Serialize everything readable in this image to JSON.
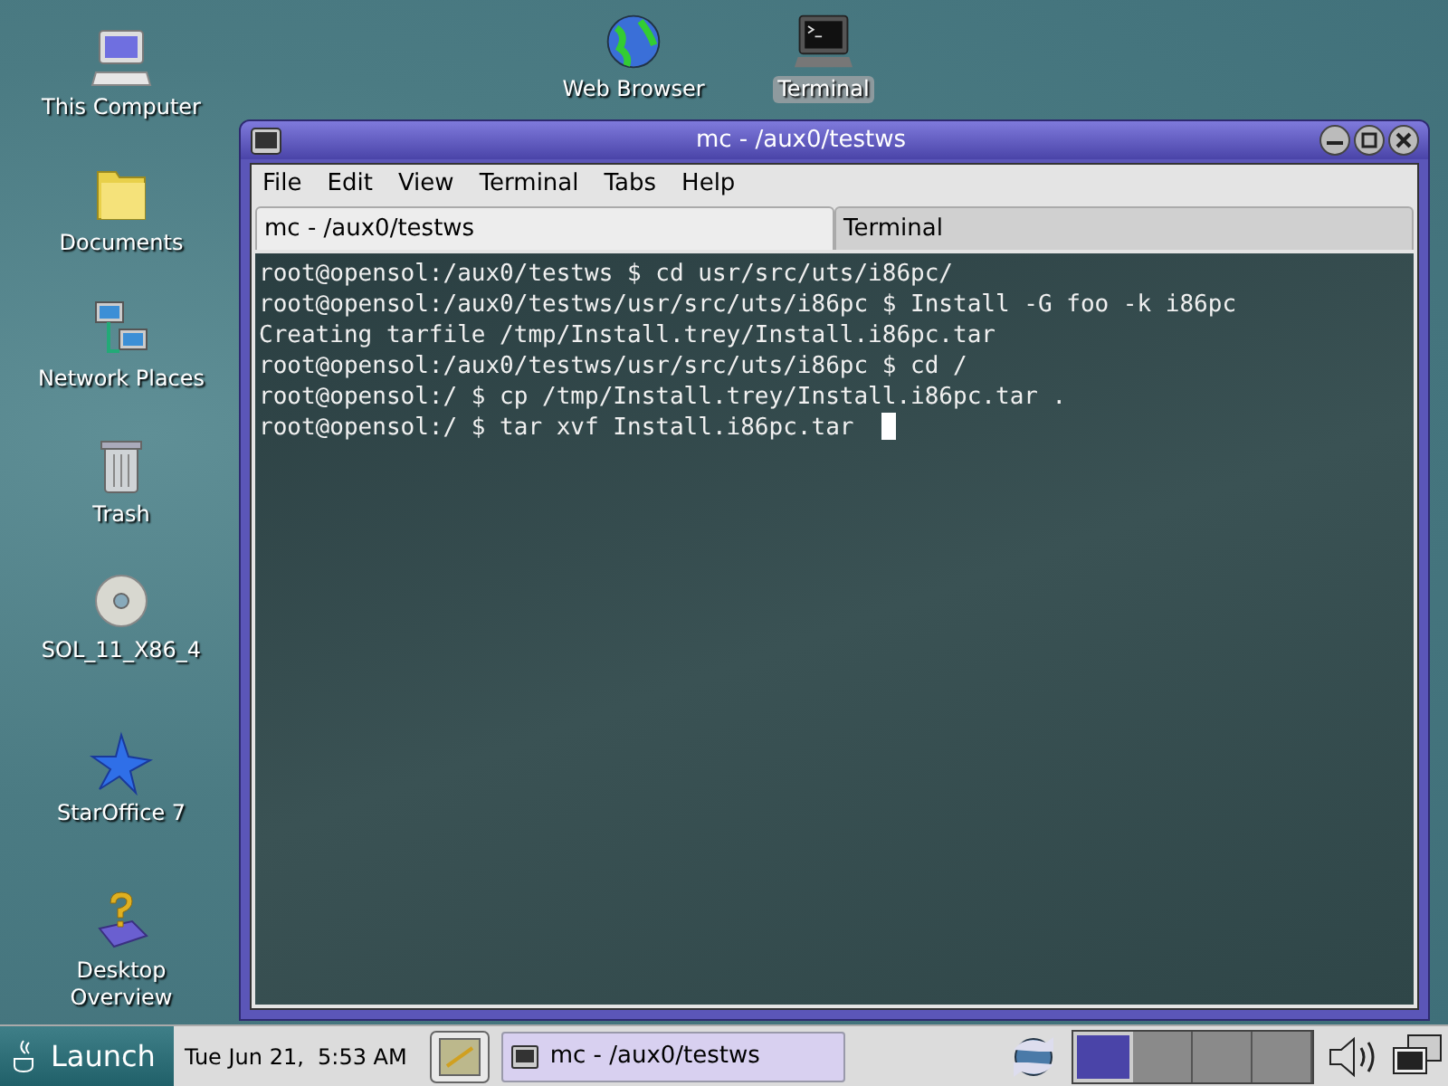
{
  "desktop_icons": [
    {
      "kind": "computer",
      "label": "This Computer"
    },
    {
      "kind": "folder",
      "label": "Documents"
    },
    {
      "kind": "network",
      "label": "Network Places"
    },
    {
      "kind": "trash",
      "label": "Trash"
    },
    {
      "kind": "disc",
      "label": "SOL_11_X86_4"
    },
    {
      "kind": "star",
      "label": "StarOffice 7"
    },
    {
      "kind": "help",
      "label": "Desktop Overview"
    }
  ],
  "top_icons": [
    {
      "kind": "globe",
      "label": "Web Browser",
      "selected": false
    },
    {
      "kind": "terminal",
      "label": "Terminal",
      "selected": true
    }
  ],
  "window": {
    "title": "mc - /aux0/testws",
    "menu": [
      "File",
      "Edit",
      "View",
      "Terminal",
      "Tabs",
      "Help"
    ],
    "tabs": [
      {
        "label": "mc - /aux0/testws",
        "selected": true
      },
      {
        "label": "Terminal",
        "selected": false
      }
    ],
    "lines": [
      "root@opensol:/aux0/testws $ cd usr/src/uts/i86pc/",
      "root@opensol:/aux0/testws/usr/src/uts/i86pc $ Install -G foo -k i86pc",
      "Creating tarfile /tmp/Install.trey/Install.i86pc.tar",
      "root@opensol:/aux0/testws/usr/src/uts/i86pc $ cd /",
      "root@opensol:/ $ cp /tmp/Install.trey/Install.i86pc.tar .",
      "root@opensol:/ $ tar xvf Install.i86pc.tar"
    ],
    "cursor_visible": true
  },
  "taskbar": {
    "launch": "Launch",
    "clock": "Tue Jun 21,  5:53 AM",
    "tasks": [
      {
        "label": "mc - /aux0/testws",
        "selected": true
      }
    ],
    "workspaces": [
      {
        "selected": true
      },
      {
        "selected": false
      },
      {
        "selected": false
      },
      {
        "selected": false
      }
    ]
  }
}
